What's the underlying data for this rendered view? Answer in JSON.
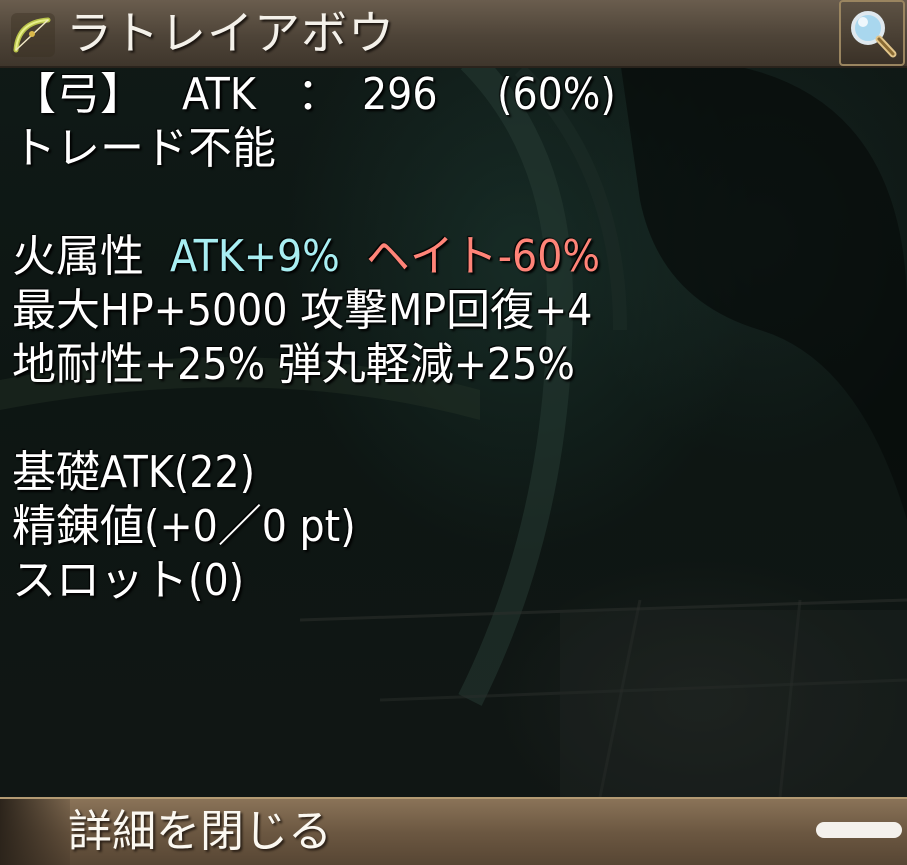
{
  "item": {
    "name": "ラトレイアボウ",
    "icon": "bow-icon"
  },
  "header": {
    "search_icon": "magnifier-icon"
  },
  "stats": {
    "type": "【弓】",
    "atk_label": "ATK",
    "colon": "：",
    "atk_value": "296",
    "atk_percent": "(60%)",
    "trade": "トレード不能"
  },
  "effects": {
    "element": "火属性",
    "atk_bonus": "ATK+9%",
    "hate": "ヘイト-60%",
    "line2": "最大HP+5000 攻撃MP回復+4",
    "line3": "地耐性+25% 弾丸軽減+25%"
  },
  "details": {
    "base_atk": "基礎ATK(22)",
    "refine": "精錬値(+0／0 pt)",
    "slot": "スロット(0)"
  },
  "footer": {
    "close_label": "詳細を閉じる"
  },
  "colors": {
    "cyan": "#a8eef2",
    "red": "#ff8478",
    "title_bar": "#4e4438",
    "footer_bar": "#6b5741"
  }
}
